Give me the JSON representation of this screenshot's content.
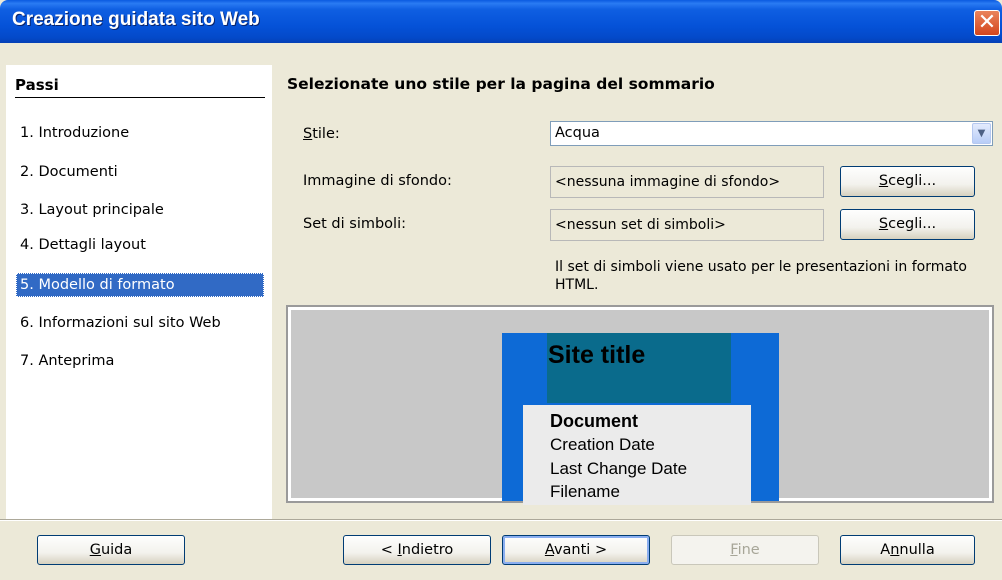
{
  "window": {
    "title": "Creazione guidata sito Web"
  },
  "sidebar": {
    "heading": "Passi",
    "steps": [
      {
        "label": "1.  Introduzione"
      },
      {
        "label": "2.  Documenti"
      },
      {
        "label": "3.  Layout principale"
      },
      {
        "label": "4.  Dettagli layout"
      },
      {
        "label": "5.  Modello di formato"
      },
      {
        "label": "6.  Informazioni sul sito Web"
      },
      {
        "label": "7.  Anteprima"
      }
    ],
    "selected_index": 4
  },
  "main": {
    "title": "Selezionate uno stile per la pagina del sommario",
    "style": {
      "label_pre": "S",
      "label_rest": "tile:",
      "value": "Acqua"
    },
    "background": {
      "label": "Immagine di sfondo:",
      "value": "<nessuna immagine di sfondo>",
      "button_pre": "S",
      "button_rest": "cegli..."
    },
    "symbols": {
      "label": "Set di simboli:",
      "value": "<nessun set di simboli>",
      "button_pre": "S",
      "button_rest": "cegli..."
    },
    "info_text": "Il set di simboli viene usato per le presentazioni in formato HTML."
  },
  "preview": {
    "site_title": "Site title",
    "doc_heading": "Document",
    "line1": "Creation Date",
    "line2": "Last Change Date",
    "line3": "Filename",
    "colors": {
      "page": "#0d6ad6",
      "header": "#0a6b8c",
      "doc": "#ebebeb",
      "canvas": "#c8c8c8"
    }
  },
  "footer": {
    "help": {
      "pre": "G",
      "rest": "uida"
    },
    "back": {
      "before": "< ",
      "pre": "I",
      "rest": "ndietro"
    },
    "next": {
      "pre": "A",
      "rest": "vanti >"
    },
    "finish": {
      "pre": "F",
      "rest": "ine"
    },
    "cancel": {
      "before": "A",
      "pre": "n",
      "rest": "nulla"
    }
  },
  "colors": {
    "title_bar": "#0552d8",
    "selection": "#316ac5",
    "dialog": "#ece9d8",
    "close": "#d4451c"
  }
}
